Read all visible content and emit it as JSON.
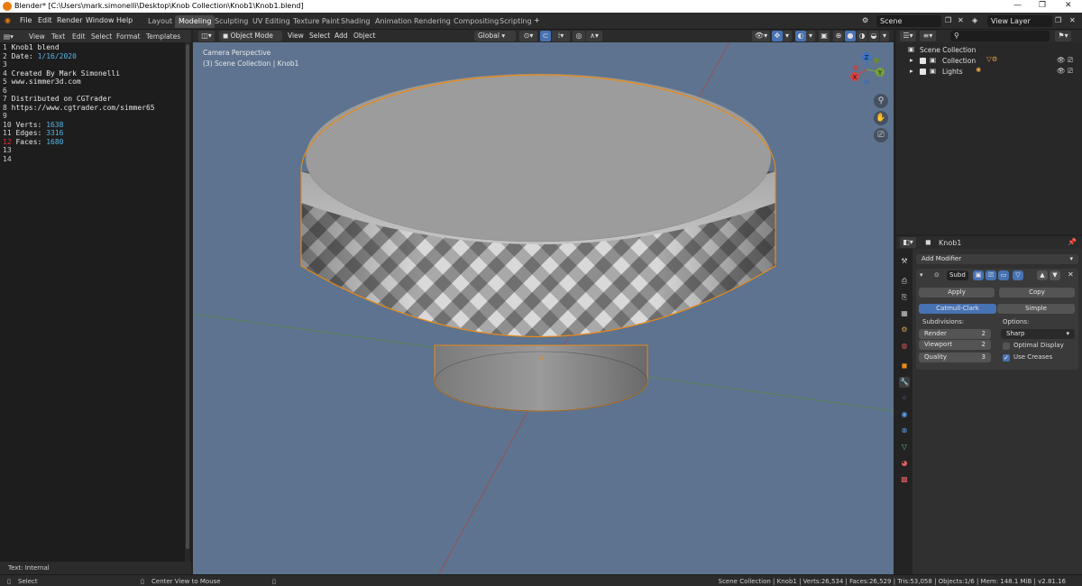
{
  "window": {
    "title": "Blender* [C:\\Users\\mark.simonelli\\Desktop\\Knob Collection\\Knob1\\Knob1.blend]",
    "controls": [
      "—",
      "❐",
      "✕"
    ]
  },
  "menu": [
    "File",
    "Edit",
    "Render",
    "Window",
    "Help"
  ],
  "workspaces": {
    "tabs": [
      "Layout",
      "Modeling",
      "Sculpting",
      "UV Editing",
      "Texture Paint",
      "Shading",
      "Animation",
      "Rendering",
      "Compositing",
      "Scripting"
    ],
    "active": "Modeling",
    "add": "+"
  },
  "scene": {
    "name": "Scene",
    "view_layer": "View Layer"
  },
  "text_editor": {
    "menu": [
      "View",
      "Text",
      "Edit",
      "Select",
      "Format",
      "Templates"
    ],
    "lines": [
      {
        "num": "1",
        "text": "Knob1 blend",
        "hl": ""
      },
      {
        "num": "2",
        "text": "Date: ",
        "hl": "1/16/2020"
      },
      {
        "num": "3",
        "text": "",
        "hl": ""
      },
      {
        "num": "4",
        "text": "Created By Mark Simonelli",
        "hl": ""
      },
      {
        "num": "5",
        "text": "www.simmer3d.com",
        "hl": ""
      },
      {
        "num": "6",
        "text": "",
        "hl": ""
      },
      {
        "num": "7",
        "text": "Distributed on CGTrader",
        "hl": ""
      },
      {
        "num": "8",
        "text": "https://www.cgtrader.com/simmer65",
        "hl": ""
      },
      {
        "num": "9",
        "text": "",
        "hl": ""
      },
      {
        "num": "10",
        "text": "Verts: ",
        "hl": "1638"
      },
      {
        "num": "11",
        "text": "Edges: ",
        "hl": "3316"
      },
      {
        "num": "12",
        "text": "Faces: ",
        "hl": "1680"
      },
      {
        "num": "13",
        "text": "",
        "hl": ""
      },
      {
        "num": "14",
        "text": "",
        "hl": ""
      }
    ],
    "current_line": "12",
    "footer": "Text: Internal"
  },
  "viewport": {
    "mode": "Object Mode",
    "menu": [
      "View",
      "Select",
      "Add",
      "Object"
    ],
    "orientation": "Global",
    "overlay_title": "Camera Perspective",
    "overlay_subtitle": "(3) Scene Collection | Knob1",
    "gizmo_axes": [
      "X",
      "Y",
      "Z"
    ]
  },
  "outliner": {
    "root": "Scene Collection",
    "items": [
      {
        "label": "Collection"
      },
      {
        "label": "Lights"
      }
    ]
  },
  "properties": {
    "object_name": "Knob1",
    "add_modifier": "Add Modifier",
    "modifier_name": "Subd",
    "apply": "Apply",
    "copy": "Copy",
    "catmull": "Catmull-Clark",
    "simple": "Simple",
    "subdivisions_label": "Subdivisions:",
    "options_label": "Options:",
    "render_label": "Render",
    "render_value": "2",
    "viewport_label": "Viewport",
    "viewport_value": "2",
    "quality_label": "Quality",
    "quality_value": "3",
    "uv_smooth": "Sharp",
    "optimal_display": "Optimal Display",
    "use_creases": "Use Creases"
  },
  "status": {
    "left_select": "Select",
    "center_view": "Center View to Mouse",
    "stats": "Scene Collection | Knob1 | Verts:26,534 | Faces:26,529 | Tris:53,058 | Objects:1/6 | Mem: 148.1 MiB | v2.81.16"
  },
  "colors": {
    "accent": "#4772b3",
    "selection_outline": "#e88a1a",
    "viewport_bg": "#5d738f",
    "knob": "#8f8f8f"
  }
}
